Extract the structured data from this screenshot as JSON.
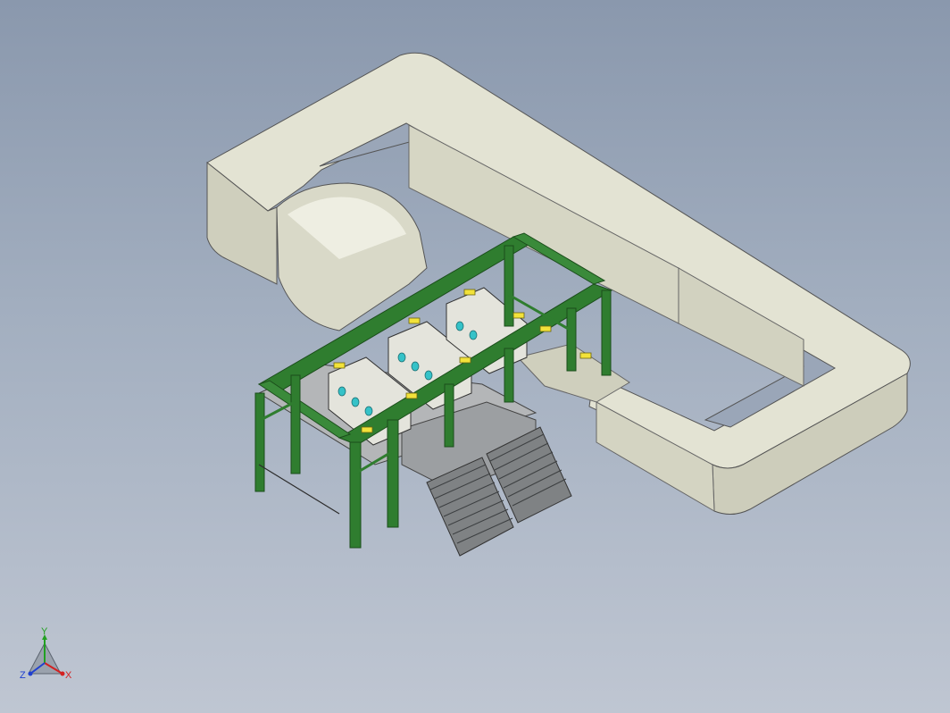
{
  "triad": {
    "y_label": "Y",
    "x_label": "X",
    "z_label": "Z",
    "colors": {
      "x": "#d42020",
      "y": "#22a022",
      "z": "#2040d0"
    }
  },
  "colors": {
    "duct": "#d8d8c6",
    "duct_shade": "#b9b9a6",
    "duct_top": "#e6e6d8",
    "frame_green": "#2f7d2f",
    "frame_dark": "#1e5a1e",
    "highlight_yellow": "#f2e23a",
    "window_cyan": "#35c2c8",
    "floor_gray": "#a9acae"
  }
}
